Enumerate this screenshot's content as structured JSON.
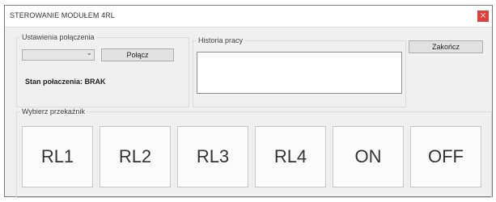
{
  "window": {
    "title": "STEROWANIE MODUŁEM 4RL",
    "close_glyph": "×"
  },
  "connection": {
    "legend": "Ustawienia połączenia",
    "port_selected": "",
    "connect_label": "Połącz",
    "status_text": "Stan połaczenia: BRAK"
  },
  "history": {
    "legend": "Historia pracy",
    "content": ""
  },
  "actions": {
    "end_label": "Zakończ"
  },
  "relays": {
    "legend": "Wybierz przekaźnik",
    "buttons": [
      "RL1",
      "RL2",
      "RL3",
      "RL4",
      "ON",
      "OFF"
    ]
  },
  "colors": {
    "close_button": "#e0403a",
    "window_bg": "#f0f0f0"
  }
}
